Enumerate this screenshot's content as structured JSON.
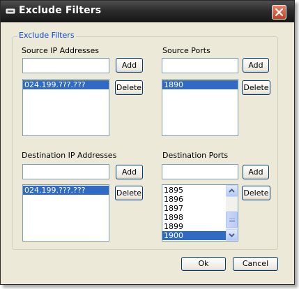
{
  "window": {
    "title": "Exclude Filters",
    "accent_color": "#316ac5",
    "title_bar_color": "#2c2c2c"
  },
  "group": {
    "legend": "Exclude Filters"
  },
  "source_ip": {
    "label": "Source IP Addresses",
    "input_value": "",
    "add_label": "Add",
    "delete_label": "Delete",
    "items": [
      "024.199.???.???"
    ],
    "selected_index": 0
  },
  "source_ports": {
    "label": "Source Ports",
    "input_value": "",
    "add_label": "Add",
    "delete_label": "Delete",
    "items": [
      "1890"
    ],
    "selected_index": 0
  },
  "destination_ip": {
    "label": "Destination IP Addresses",
    "input_value": "",
    "add_label": "Add",
    "delete_label": "Delete",
    "items": [
      "024.199.???.???"
    ],
    "selected_index": 0
  },
  "destination_ports": {
    "label": "Destination Ports",
    "input_value": "",
    "add_label": "Add",
    "delete_label": "Delete",
    "items": [
      "1895",
      "1896",
      "1897",
      "1898",
      "1899",
      "1900"
    ],
    "selected_index": 5
  },
  "footer": {
    "ok_label": "Ok",
    "cancel_label": "Cancel"
  }
}
